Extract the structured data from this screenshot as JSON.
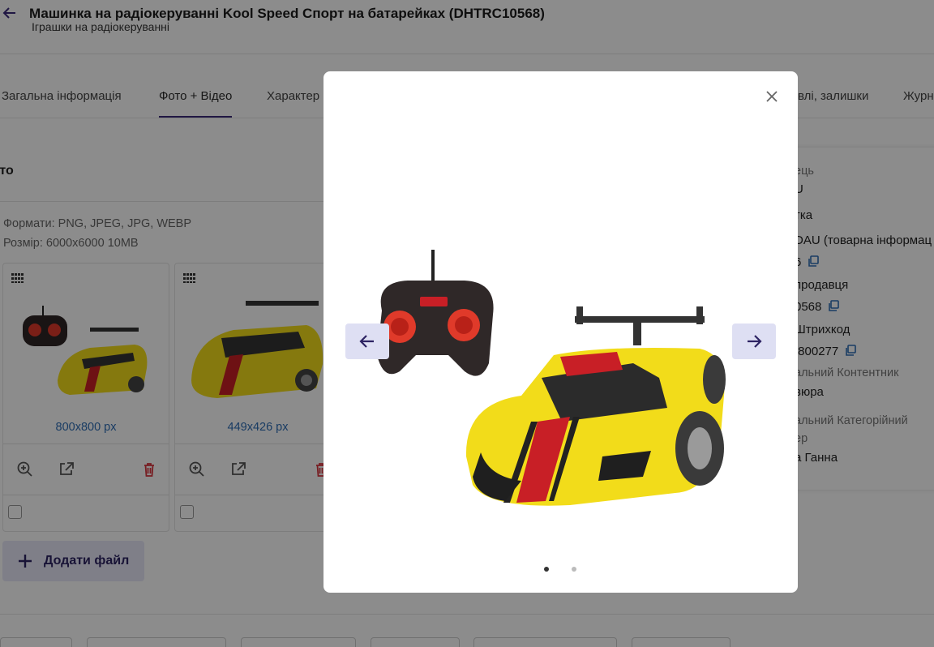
{
  "header": {
    "title": "Машинка на радіокеруванні Kool Speed Спорт на батарейках (DHTRC10568)",
    "subtitle": "Іграшки на радіокеруванні"
  },
  "tabs": [
    {
      "label": "Загальна інформація"
    },
    {
      "label": "Фото + Відео"
    },
    {
      "label": "Характер"
    },
    {
      "label": "влі, залишки"
    },
    {
      "label": "Журн"
    }
  ],
  "photos_section": {
    "title": "ото",
    "formats": "Формати: PNG, JPEG, JPG, WEBP",
    "size": "Розмір: 6000x6000 10MB",
    "cards": [
      {
        "dims": "800x800 px"
      },
      {
        "dims": "449x426 px"
      }
    ],
    "add_button_label": "Додати файл"
  },
  "side_panel": {
    "lines": [
      "ець",
      "U",
      "тка",
      "DAU (товарна інформац",
      "6",
      "продавця",
      "0568",
      "Штрихкод",
      ".800277",
      "альний Контентник",
      "вюра",
      "альний Категорійний",
      "ер",
      "а Ганна"
    ]
  },
  "modal": {
    "slide_count": 2,
    "active_slide": 1
  },
  "colors": {
    "accent": "#3b2a7a",
    "link_blue": "#2f6db5",
    "delete_red": "#d9363e",
    "nav_button_bg": "#dedff3"
  },
  "icons": {
    "back": "arrow-left-icon",
    "close": "close-icon",
    "prev": "arrow-left-icon",
    "next": "arrow-right-icon",
    "zoom": "zoom-in-icon",
    "open": "open-external-icon",
    "delete": "trash-icon",
    "copy": "copy-icon",
    "grip": "drag-grip-icon",
    "plus": "plus-icon"
  }
}
